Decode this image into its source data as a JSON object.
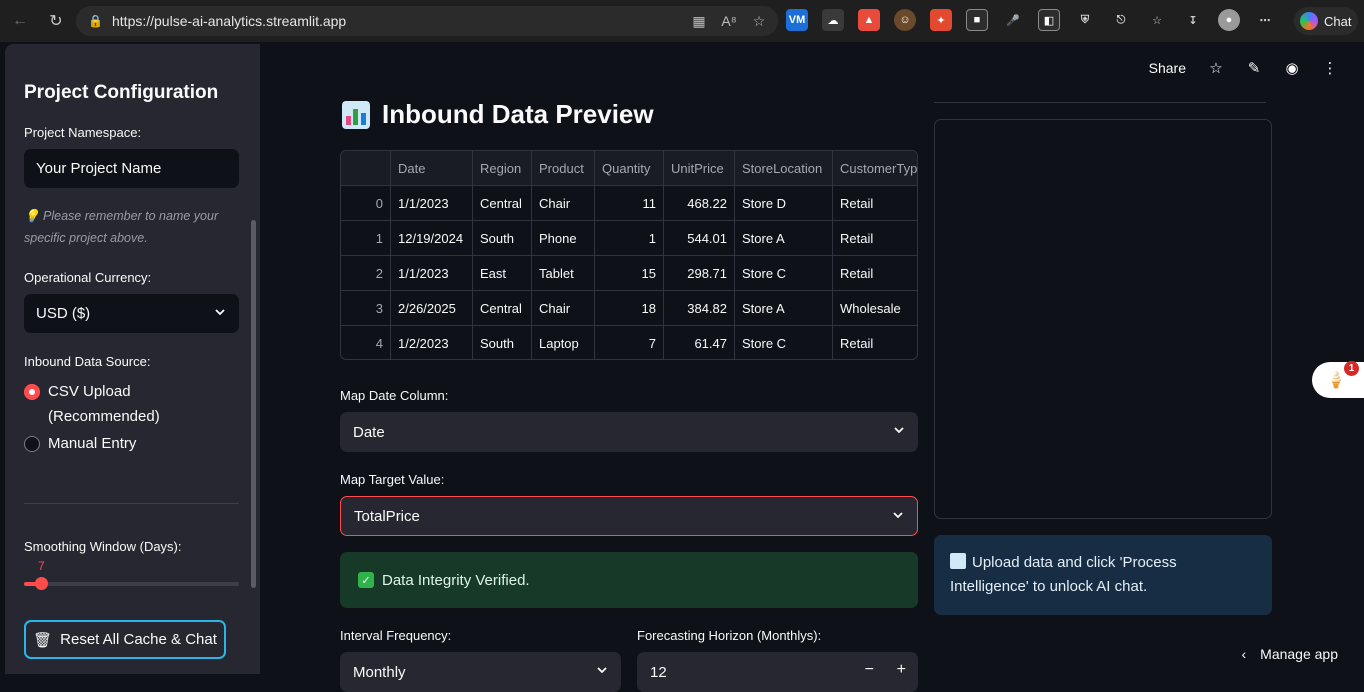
{
  "browser": {
    "url": "https://pulse-ai-analytics.streamlit.app",
    "chat_label": "Chat"
  },
  "sidebar": {
    "title": "Project Configuration",
    "namespace_label": "Project Namespace:",
    "namespace_value": "Your Project Name",
    "namespace_hint": "💡 Please remember to name your specific project above.",
    "currency_label": "Operational Currency:",
    "currency_value": "USD ($)",
    "source_label": "Inbound Data Source:",
    "source_options": [
      {
        "label": "CSV Upload (Recommended)",
        "selected": true
      },
      {
        "label": "Manual Entry",
        "selected": false
      }
    ],
    "smoothing_label": "Smoothing Window (Days):",
    "smoothing_value": "7",
    "smoothing_fraction": 0.08,
    "reset_label": "Reset All Cache & Chat"
  },
  "header": {
    "share_label": "Share"
  },
  "main": {
    "title": "Inbound Data Preview",
    "table": {
      "columns": [
        "",
        "Date",
        "Region",
        "Product",
        "Quantity",
        "UnitPrice",
        "StoreLocation",
        "CustomerTyp"
      ],
      "rows": [
        [
          "0",
          "1/1/2023",
          "Central",
          "Chair",
          "11",
          "468.22",
          "Store D",
          "Retail"
        ],
        [
          "1",
          "12/19/2024",
          "South",
          "Phone",
          "1",
          "544.01",
          "Store A",
          "Retail"
        ],
        [
          "2",
          "1/1/2023",
          "East",
          "Tablet",
          "15",
          "298.71",
          "Store C",
          "Retail"
        ],
        [
          "3",
          "2/26/2025",
          "Central",
          "Chair",
          "18",
          "384.82",
          "Store A",
          "Wholesale"
        ],
        [
          "4",
          "1/2/2023",
          "South",
          "Laptop",
          "7",
          "61.47",
          "Store C",
          "Retail"
        ]
      ]
    },
    "date_col_label": "Map Date Column:",
    "date_col_value": "Date",
    "target_label": "Map Target Value:",
    "target_value": "TotalPrice",
    "integrity_message": "Data Integrity Verified.",
    "interval_label": "Interval Frequency:",
    "interval_value": "Monthly",
    "horizon_label": "Forecasting Horizon (Monthlys):",
    "horizon_value": "12"
  },
  "right_panel": {
    "info_message": "Upload data and click 'Process Intelligence' to unlock AI chat."
  },
  "footer": {
    "manage_app_label": "Manage app"
  },
  "floating": {
    "badge_count": "1"
  },
  "colors": {
    "accent": "#ff4b4b",
    "sidebar_bg": "#262730",
    "app_bg": "#0e1117",
    "success_bg": "#173928",
    "info_bg": "#172d43",
    "button_border": "#29b5e8"
  }
}
